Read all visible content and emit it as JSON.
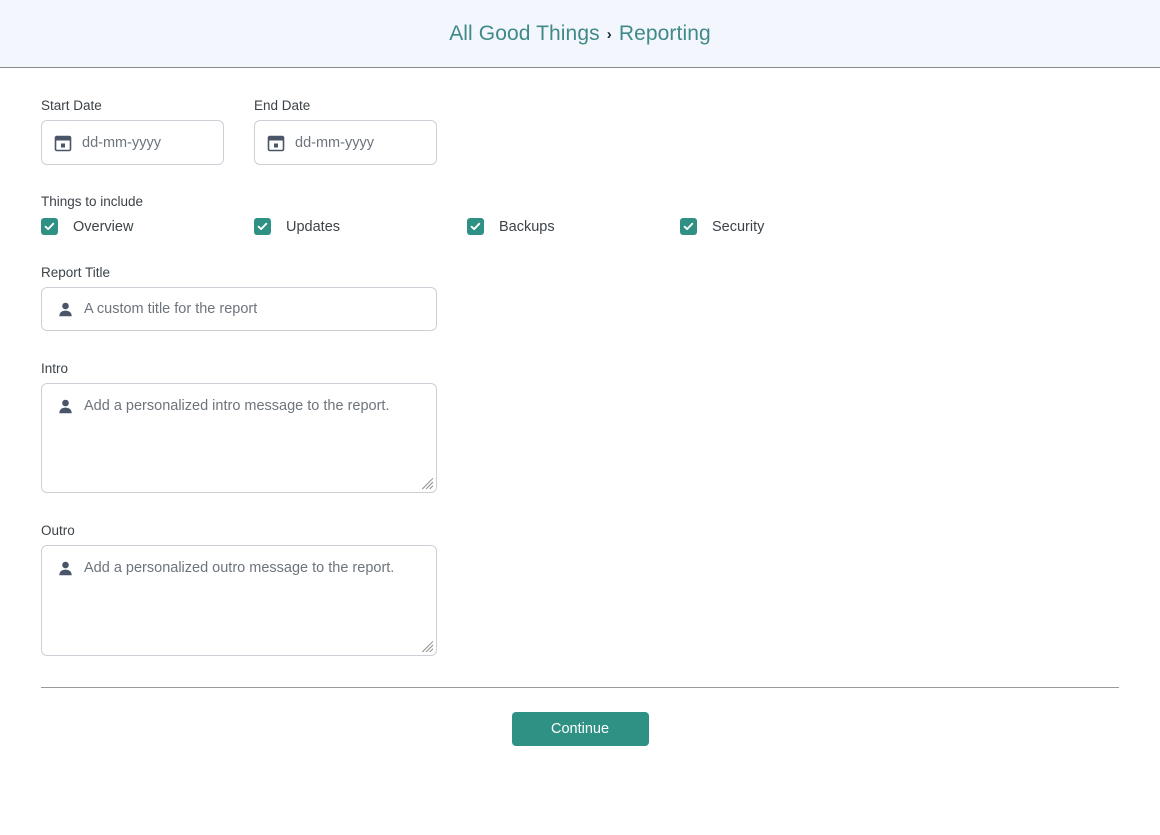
{
  "header": {
    "breadcrumb": {
      "root_label": "All Good Things",
      "separator": "›",
      "current_label": "Reporting"
    }
  },
  "form": {
    "start_date": {
      "label": "Start Date",
      "placeholder": "dd-mm-yyyy",
      "value": "",
      "icon": "calendar-icon"
    },
    "end_date": {
      "label": "End Date",
      "placeholder": "dd-mm-yyyy",
      "value": "",
      "icon": "calendar-icon"
    },
    "things_to_include": {
      "label": "Things to include",
      "items": [
        {
          "label": "Overview",
          "checked": true
        },
        {
          "label": "Updates",
          "checked": true
        },
        {
          "label": "Backups",
          "checked": true
        },
        {
          "label": "Security",
          "checked": true
        }
      ]
    },
    "report_title": {
      "label": "Report Title",
      "placeholder": "A custom title for the report",
      "value": "",
      "icon": "person-icon"
    },
    "intro": {
      "label": "Intro",
      "placeholder": "Add a personalized intro message to the report.",
      "value": "",
      "icon": "person-icon"
    },
    "outro": {
      "label": "Outro",
      "placeholder": "Add a personalized outro message to the report.",
      "value": "",
      "icon": "person-icon"
    }
  },
  "footer": {
    "continue_label": "Continue"
  },
  "colors": {
    "accent_teal": "#2e9183",
    "link_teal": "#3f8a88",
    "header_bg": "#f3f6fd",
    "icon_slate": "#4a5568",
    "placeholder_gray": "#6d747c",
    "border_gray": "#ccd0d6"
  }
}
